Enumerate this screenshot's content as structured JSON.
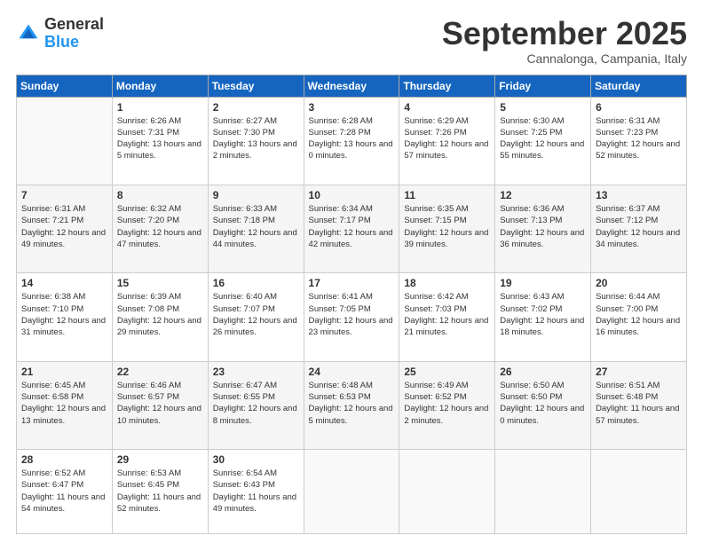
{
  "logo": {
    "general": "General",
    "blue": "Blue"
  },
  "header": {
    "month": "September 2025",
    "location": "Cannalonga, Campania, Italy"
  },
  "weekdays": [
    "Sunday",
    "Monday",
    "Tuesday",
    "Wednesday",
    "Thursday",
    "Friday",
    "Saturday"
  ],
  "weeks": [
    [
      {
        "day": "",
        "sunrise": "",
        "sunset": "",
        "daylight": ""
      },
      {
        "day": "1",
        "sunrise": "6:26 AM",
        "sunset": "7:31 PM",
        "daylight": "13 hours and 5 minutes."
      },
      {
        "day": "2",
        "sunrise": "6:27 AM",
        "sunset": "7:30 PM",
        "daylight": "13 hours and 2 minutes."
      },
      {
        "day": "3",
        "sunrise": "6:28 AM",
        "sunset": "7:28 PM",
        "daylight": "13 hours and 0 minutes."
      },
      {
        "day": "4",
        "sunrise": "6:29 AM",
        "sunset": "7:26 PM",
        "daylight": "12 hours and 57 minutes."
      },
      {
        "day": "5",
        "sunrise": "6:30 AM",
        "sunset": "7:25 PM",
        "daylight": "12 hours and 55 minutes."
      },
      {
        "day": "6",
        "sunrise": "6:31 AM",
        "sunset": "7:23 PM",
        "daylight": "12 hours and 52 minutes."
      }
    ],
    [
      {
        "day": "7",
        "sunrise": "6:31 AM",
        "sunset": "7:21 PM",
        "daylight": "12 hours and 49 minutes."
      },
      {
        "day": "8",
        "sunrise": "6:32 AM",
        "sunset": "7:20 PM",
        "daylight": "12 hours and 47 minutes."
      },
      {
        "day": "9",
        "sunrise": "6:33 AM",
        "sunset": "7:18 PM",
        "daylight": "12 hours and 44 minutes."
      },
      {
        "day": "10",
        "sunrise": "6:34 AM",
        "sunset": "7:17 PM",
        "daylight": "12 hours and 42 minutes."
      },
      {
        "day": "11",
        "sunrise": "6:35 AM",
        "sunset": "7:15 PM",
        "daylight": "12 hours and 39 minutes."
      },
      {
        "day": "12",
        "sunrise": "6:36 AM",
        "sunset": "7:13 PM",
        "daylight": "12 hours and 36 minutes."
      },
      {
        "day": "13",
        "sunrise": "6:37 AM",
        "sunset": "7:12 PM",
        "daylight": "12 hours and 34 minutes."
      }
    ],
    [
      {
        "day": "14",
        "sunrise": "6:38 AM",
        "sunset": "7:10 PM",
        "daylight": "12 hours and 31 minutes."
      },
      {
        "day": "15",
        "sunrise": "6:39 AM",
        "sunset": "7:08 PM",
        "daylight": "12 hours and 29 minutes."
      },
      {
        "day": "16",
        "sunrise": "6:40 AM",
        "sunset": "7:07 PM",
        "daylight": "12 hours and 26 minutes."
      },
      {
        "day": "17",
        "sunrise": "6:41 AM",
        "sunset": "7:05 PM",
        "daylight": "12 hours and 23 minutes."
      },
      {
        "day": "18",
        "sunrise": "6:42 AM",
        "sunset": "7:03 PM",
        "daylight": "12 hours and 21 minutes."
      },
      {
        "day": "19",
        "sunrise": "6:43 AM",
        "sunset": "7:02 PM",
        "daylight": "12 hours and 18 minutes."
      },
      {
        "day": "20",
        "sunrise": "6:44 AM",
        "sunset": "7:00 PM",
        "daylight": "12 hours and 16 minutes."
      }
    ],
    [
      {
        "day": "21",
        "sunrise": "6:45 AM",
        "sunset": "6:58 PM",
        "daylight": "12 hours and 13 minutes."
      },
      {
        "day": "22",
        "sunrise": "6:46 AM",
        "sunset": "6:57 PM",
        "daylight": "12 hours and 10 minutes."
      },
      {
        "day": "23",
        "sunrise": "6:47 AM",
        "sunset": "6:55 PM",
        "daylight": "12 hours and 8 minutes."
      },
      {
        "day": "24",
        "sunrise": "6:48 AM",
        "sunset": "6:53 PM",
        "daylight": "12 hours and 5 minutes."
      },
      {
        "day": "25",
        "sunrise": "6:49 AM",
        "sunset": "6:52 PM",
        "daylight": "12 hours and 2 minutes."
      },
      {
        "day": "26",
        "sunrise": "6:50 AM",
        "sunset": "6:50 PM",
        "daylight": "12 hours and 0 minutes."
      },
      {
        "day": "27",
        "sunrise": "6:51 AM",
        "sunset": "6:48 PM",
        "daylight": "11 hours and 57 minutes."
      }
    ],
    [
      {
        "day": "28",
        "sunrise": "6:52 AM",
        "sunset": "6:47 PM",
        "daylight": "11 hours and 54 minutes."
      },
      {
        "day": "29",
        "sunrise": "6:53 AM",
        "sunset": "6:45 PM",
        "daylight": "11 hours and 52 minutes."
      },
      {
        "day": "30",
        "sunrise": "6:54 AM",
        "sunset": "6:43 PM",
        "daylight": "11 hours and 49 minutes."
      },
      {
        "day": "",
        "sunrise": "",
        "sunset": "",
        "daylight": ""
      },
      {
        "day": "",
        "sunrise": "",
        "sunset": "",
        "daylight": ""
      },
      {
        "day": "",
        "sunrise": "",
        "sunset": "",
        "daylight": ""
      },
      {
        "day": "",
        "sunrise": "",
        "sunset": "",
        "daylight": ""
      }
    ]
  ]
}
